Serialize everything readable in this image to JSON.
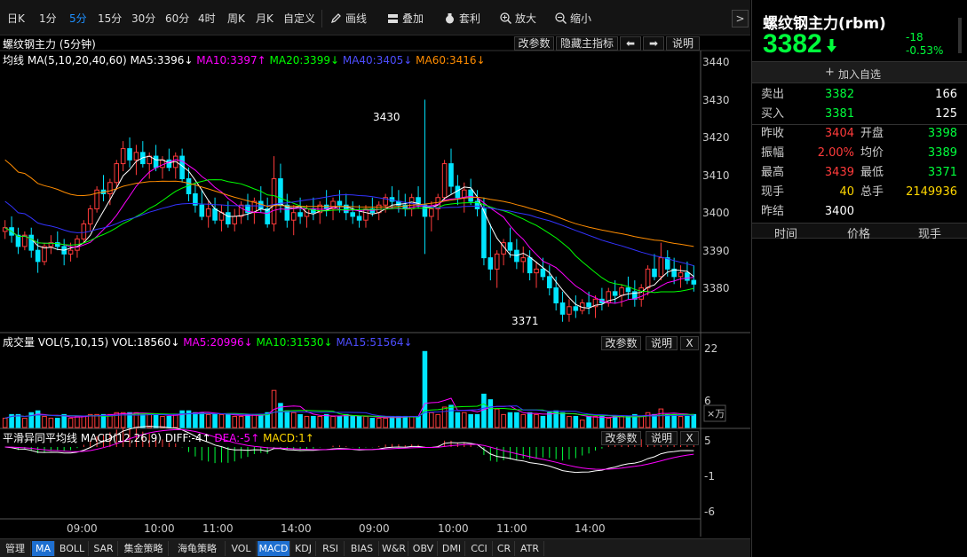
{
  "toolbar": {
    "periods": [
      "日K",
      "1分",
      "5分",
      "15分",
      "30分",
      "60分",
      "4时",
      "周K",
      "月K",
      "自定义"
    ],
    "active_period": "5分",
    "tools": [
      "画线",
      "叠加",
      "套利",
      "放大",
      "缩小"
    ]
  },
  "main_panel": {
    "title": "螺纹钢主力 (5分钟)",
    "ma_label": "均线",
    "ma_params": "MA(5,10,20,40,60)",
    "ma5": "MA5:3396↓",
    "ma10": "MA10:3397↑",
    "ma20": "MA20:3399↓",
    "ma40": "MA40:3405↓",
    "ma60": "MA60:3416↓",
    "buttons": [
      "改参数",
      "隐藏主指标",
      "⬅",
      "➡",
      "说明"
    ],
    "y_ticks": [
      "3440",
      "3430",
      "3420",
      "3410",
      "3400",
      "3390",
      "3380"
    ],
    "high_label": "3430",
    "low_label": "3371"
  },
  "vol_panel": {
    "title": "成交量",
    "params": "VOL(5,10,15)",
    "vol": "VOL:18560↓",
    "ma5": "MA5:20996↓",
    "ma10": "MA10:31530↓",
    "ma15": "MA15:51564↓",
    "buttons": [
      "改参数",
      "说明",
      "X"
    ],
    "y_ticks": [
      "22",
      "6"
    ],
    "unit": "×万"
  },
  "macd_panel": {
    "title": "平滑异同平均线",
    "params": "MACD(12,26,9)",
    "diff": "DIFF:-4↑",
    "dea": "DEA:-5↑",
    "macd": "MACD:1↑",
    "buttons": [
      "改参数",
      "说明",
      "X"
    ],
    "y_ticks": [
      "5",
      "-1",
      "-6"
    ]
  },
  "x_axis": [
    "09:00",
    "10:00",
    "11:00",
    "14:00",
    "09:00",
    "10:00",
    "11:00",
    "14:00"
  ],
  "bottom_tabs": [
    "管理",
    "MA",
    "BOLL",
    "SAR",
    "集金策略",
    "海龟策略",
    "VOL",
    "MACD",
    "KDJ",
    "RSI",
    "BIAS",
    "W&R",
    "OBV",
    "DMI",
    "CCI",
    "CR",
    "ATR"
  ],
  "active_tabs": [
    "MA",
    "MACD"
  ],
  "quote": {
    "name": "螺纹钢主力(rbm)",
    "price": "3382",
    "change": "-18",
    "change_pct": "-0.53%",
    "add_watch": "加入自选",
    "sell_label": "卖出",
    "sell_price": "3382",
    "sell_vol": "166",
    "buy_label": "买入",
    "buy_price": "3381",
    "buy_vol": "125",
    "stats": [
      {
        "l1": "昨收",
        "v1": "3404",
        "l2": "开盘",
        "v2": "3398"
      },
      {
        "l1": "振幅",
        "v1": "2.00%",
        "l2": "均价",
        "v2": "3389"
      },
      {
        "l1": "最高",
        "v1": "3439",
        "l2": "最低",
        "v2": "3371"
      },
      {
        "l1": "现手",
        "v1": "40",
        "l2": "总手",
        "v2": "2149936"
      },
      {
        "l1": "昨结",
        "v1": "3400",
        "l2": "",
        "v2": ""
      }
    ],
    "ticks_header": [
      "时间",
      "价格",
      "现手"
    ]
  },
  "colors": {
    "up": "#ff3b3b",
    "down": "#00e5ff",
    "ma5": "#ffffff",
    "ma10": "#ff00ff",
    "ma20": "#00ff00",
    "ma40": "#3333ff",
    "ma60": "#ff8c00",
    "green": "#00ff3c",
    "red": "#ff3b3b",
    "yellow": "#ffd700"
  },
  "chart_data": {
    "type": "candlestick",
    "candles": [
      [
        3395,
        3398,
        3393,
        3396
      ],
      [
        3396,
        3399,
        3392,
        3394
      ],
      [
        3394,
        3396,
        3389,
        3391
      ],
      [
        3391,
        3395,
        3390,
        3394
      ],
      [
        3394,
        3396,
        3388,
        3390
      ],
      [
        3390,
        3393,
        3384,
        3387
      ],
      [
        3387,
        3392,
        3386,
        3391
      ],
      [
        3391,
        3394,
        3389,
        3392
      ],
      [
        3392,
        3395,
        3390,
        3391
      ],
      [
        3391,
        3393,
        3386,
        3389
      ],
      [
        3389,
        3392,
        3387,
        3390
      ],
      [
        3390,
        3394,
        3388,
        3393
      ],
      [
        3393,
        3398,
        3392,
        3397
      ],
      [
        3397,
        3402,
        3395,
        3401
      ],
      [
        3401,
        3407,
        3400,
        3406
      ],
      [
        3406,
        3410,
        3403,
        3405
      ],
      [
        3405,
        3409,
        3402,
        3408
      ],
      [
        3408,
        3414,
        3406,
        3413
      ],
      [
        3413,
        3419,
        3411,
        3417
      ],
      [
        3417,
        3420,
        3412,
        3414
      ],
      [
        3414,
        3418,
        3410,
        3416
      ],
      [
        3416,
        3419,
        3412,
        3413
      ],
      [
        3413,
        3416,
        3409,
        3415
      ],
      [
        3415,
        3418,
        3411,
        3412
      ],
      [
        3412,
        3415,
        3409,
        3414
      ],
      [
        3414,
        3417,
        3411,
        3412
      ],
      [
        3412,
        3416,
        3409,
        3415
      ],
      [
        3415,
        3417,
        3408,
        3409
      ],
      [
        3409,
        3412,
        3403,
        3405
      ],
      [
        3405,
        3408,
        3400,
        3402
      ],
      [
        3402,
        3406,
        3398,
        3399
      ],
      [
        3399,
        3403,
        3396,
        3401
      ],
      [
        3401,
        3404,
        3397,
        3398
      ],
      [
        3398,
        3402,
        3395,
        3400
      ],
      [
        3400,
        3403,
        3396,
        3397
      ],
      [
        3397,
        3401,
        3395,
        3399
      ],
      [
        3399,
        3403,
        3397,
        3402
      ],
      [
        3402,
        3405,
        3398,
        3400
      ],
      [
        3400,
        3404,
        3397,
        3403
      ],
      [
        3403,
        3407,
        3400,
        3401
      ],
      [
        3401,
        3404,
        3396,
        3397
      ],
      [
        3397,
        3415,
        3395,
        3409
      ],
      [
        3409,
        3413,
        3400,
        3402
      ],
      [
        3402,
        3405,
        3396,
        3398
      ],
      [
        3398,
        3402,
        3394,
        3400
      ],
      [
        3400,
        3404,
        3397,
        3399
      ],
      [
        3399,
        3402,
        3396,
        3401
      ],
      [
        3401,
        3404,
        3398,
        3400
      ],
      [
        3400,
        3403,
        3397,
        3402
      ],
      [
        3402,
        3406,
        3399,
        3401
      ],
      [
        3401,
        3404,
        3398,
        3403
      ],
      [
        3403,
        3406,
        3400,
        3402
      ],
      [
        3402,
        3405,
        3398,
        3400
      ],
      [
        3400,
        3403,
        3397,
        3399
      ],
      [
        3399,
        3402,
        3396,
        3398
      ],
      [
        3398,
        3402,
        3396,
        3401
      ],
      [
        3401,
        3404,
        3399,
        3400
      ],
      [
        3400,
        3403,
        3398,
        3402
      ],
      [
        3402,
        3405,
        3400,
        3404
      ],
      [
        3404,
        3407,
        3401,
        3403
      ],
      [
        3403,
        3406,
        3400,
        3402
      ],
      [
        3402,
        3405,
        3399,
        3401
      ],
      [
        3401,
        3405,
        3399,
        3404
      ],
      [
        3404,
        3407,
        3401,
        3402
      ],
      [
        3402,
        3430,
        3389,
        3399
      ],
      [
        3399,
        3403,
        3395,
        3401
      ],
      [
        3401,
        3405,
        3398,
        3404
      ],
      [
        3404,
        3414,
        3403,
        3413
      ],
      [
        3413,
        3417,
        3405,
        3407
      ],
      [
        3407,
        3410,
        3402,
        3404
      ],
      [
        3404,
        3408,
        3400,
        3406
      ],
      [
        3406,
        3409,
        3402,
        3403
      ],
      [
        3403,
        3406,
        3399,
        3401
      ],
      [
        3401,
        3404,
        3386,
        3388
      ],
      [
        3388,
        3397,
        3382,
        3385
      ],
      [
        3385,
        3390,
        3380,
        3389
      ],
      [
        3389,
        3393,
        3386,
        3392
      ],
      [
        3392,
        3396,
        3388,
        3390
      ],
      [
        3390,
        3393,
        3385,
        3387
      ],
      [
        3387,
        3391,
        3384,
        3388
      ],
      [
        3388,
        3390,
        3382,
        3384
      ],
      [
        3384,
        3387,
        3380,
        3385
      ],
      [
        3385,
        3388,
        3382,
        3383
      ],
      [
        3383,
        3386,
        3378,
        3380
      ],
      [
        3380,
        3383,
        3374,
        3376
      ],
      [
        3376,
        3379,
        3371,
        3373
      ],
      [
        3373,
        3377,
        3371,
        3375
      ],
      [
        3375,
        3378,
        3372,
        3374
      ],
      [
        3374,
        3377,
        3373,
        3376
      ],
      [
        3376,
        3379,
        3373,
        3375
      ],
      [
        3375,
        3378,
        3372,
        3377
      ],
      [
        3377,
        3380,
        3374,
        3376
      ],
      [
        3376,
        3380,
        3375,
        3379
      ],
      [
        3379,
        3382,
        3376,
        3378
      ],
      [
        3378,
        3381,
        3375,
        3380
      ],
      [
        3380,
        3383,
        3377,
        3379
      ],
      [
        3379,
        3382,
        3375,
        3377
      ],
      [
        3377,
        3381,
        3375,
        3380
      ],
      [
        3380,
        3386,
        3378,
        3385
      ],
      [
        3385,
        3389,
        3382,
        3383
      ],
      [
        3383,
        3392,
        3382,
        3388
      ],
      [
        3388,
        3390,
        3383,
        3385
      ],
      [
        3385,
        3388,
        3381,
        3383
      ],
      [
        3383,
        3386,
        3380,
        3384
      ],
      [
        3384,
        3387,
        3381,
        3382
      ],
      [
        3382,
        3386,
        3379,
        3381
      ]
    ],
    "ylim": [
      3370,
      3440
    ]
  }
}
